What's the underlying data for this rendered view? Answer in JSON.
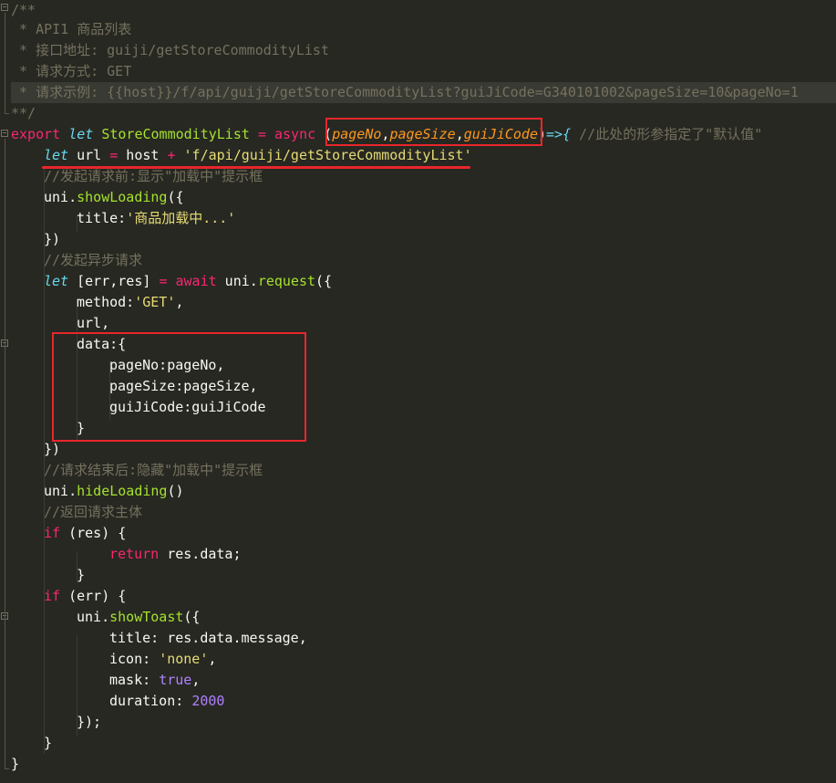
{
  "colors": {
    "background": "#272822",
    "comment": "#75715e",
    "keyword": "#f92672",
    "storage": "#66d9ef",
    "function": "#a6e22e",
    "string": "#e6db74",
    "number": "#ae81ff",
    "parameter": "#fd971f",
    "annotation": "#e8262b"
  },
  "code": {
    "l1": "/**",
    "l2": " * API1 商品列表",
    "l3": " * 接口地址: guiji/getStoreCommodityList",
    "l4": " * 请求方式: GET",
    "l5": " * 请求示例: {{host}}/f/api/guiji/getStoreCommodityList?guiJiCode=G340101002&pageSize=10&pageNo=1",
    "l6": "**/",
    "l7": {
      "export": "export",
      "let": "let",
      "name": "StoreCommodityList",
      "eq": " = ",
      "async": "async",
      "open": " (",
      "p1": "pageNo",
      "p2": "pageSize",
      "p3": "guiJiCode",
      "comma": ",",
      "close": ")",
      "arrow": "=>{ ",
      "comment": "//此处的形参指定了\"默认值\""
    },
    "l8": {
      "let": "let",
      "var": " url ",
      "eq": "=",
      "host": " host ",
      "plus": "+",
      "path": " 'f/api/guiji/getStoreCommodityList'"
    },
    "l9": "//发起请求前:显示\"加载中\"提示框",
    "l10": {
      "obj": "uni.",
      "fn": "showLoading",
      "rest": "({"
    },
    "l11": {
      "key": "title:",
      "val": "'商品加载中...'"
    },
    "l12": "})",
    "l13": "//发起异步请求",
    "l14": {
      "let": "let",
      "vars": " [err,res] ",
      "eq": "=",
      "await": " await",
      "obj": " uni.",
      "fn": "request",
      "rest": "({"
    },
    "l15": {
      "key": "method:",
      "val": "'GET'",
      "rest": ","
    },
    "l16": "url,",
    "l17": "data:{",
    "l18": "pageNo:pageNo,",
    "l19": "pageSize:pageSize,",
    "l20": "guiJiCode:guiJiCode",
    "l21": "}",
    "l22": "})",
    "l23": "//请求结束后:隐藏\"加载中\"提示框",
    "l24": {
      "obj": "uni.",
      "fn": "hideLoading",
      "rest": "()"
    },
    "l25": "//返回请求主体",
    "l26": {
      "kw": "if",
      "rest": " (res) {"
    },
    "l27": {
      "kw": "return",
      "rest": " res.data;"
    },
    "l28": "}",
    "l29": {
      "kw": "if",
      "rest": " (err) {"
    },
    "l30": {
      "obj": "uni.",
      "fn": "showToast",
      "rest": "({"
    },
    "l31": "title: res.data.message,",
    "l32": {
      "key": "icon: ",
      "val": "'none'",
      "rest": ","
    },
    "l33": {
      "key": "mask: ",
      "val": "true",
      "rest": ","
    },
    "l34": {
      "key": "duration: ",
      "val": "2000"
    },
    "l35": "});",
    "l36": "}",
    "l37": "}"
  }
}
